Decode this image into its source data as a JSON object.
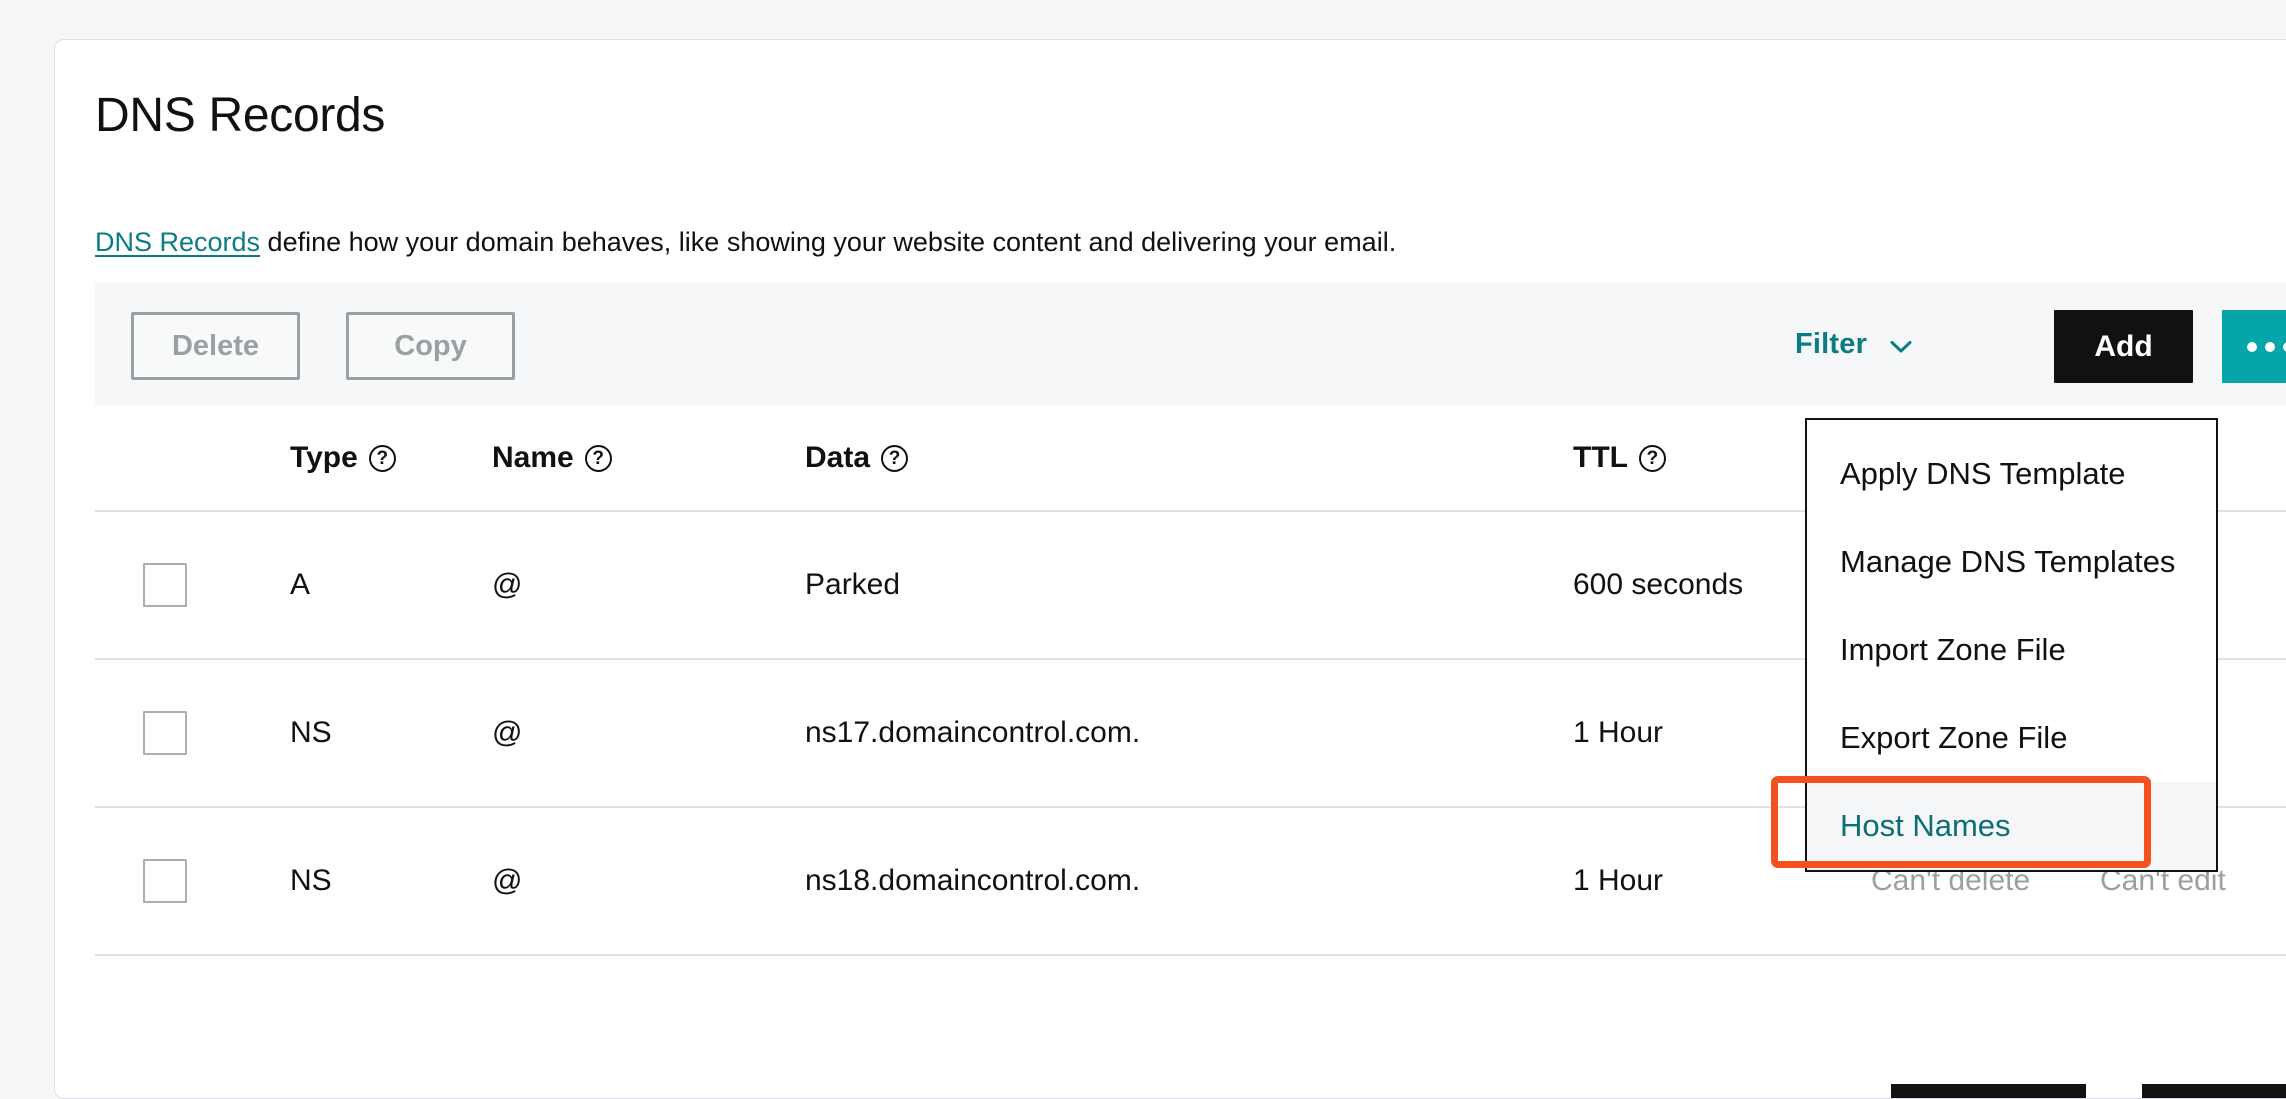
{
  "page": {
    "title": "DNS Records",
    "intro_link": "DNS Records",
    "intro_rest": " define how your domain behaves, like showing your website content and delivering your email."
  },
  "toolbar": {
    "delete_label": "Delete",
    "copy_label": "Copy",
    "filter_label": "Filter",
    "filter_chevron_icon": "chevron-down-icon",
    "add_label": "Add",
    "more_icon": "ellipsis-icon"
  },
  "menu": {
    "items": [
      {
        "label": "Apply DNS Template",
        "highlighted": false
      },
      {
        "label": "Manage DNS Templates",
        "highlighted": false
      },
      {
        "label": "Import Zone File",
        "highlighted": false
      },
      {
        "label": "Export Zone File",
        "highlighted": false
      },
      {
        "label": "Host Names",
        "highlighted": true
      }
    ]
  },
  "table": {
    "headers": {
      "type": "Type",
      "name": "Name",
      "data": "Data",
      "ttl": "TTL",
      "help_icon": "?"
    },
    "rows": [
      {
        "type": "A",
        "name": "@",
        "data": "Parked",
        "ttl": "600 seconds",
        "delete_action": "",
        "edit_action": ""
      },
      {
        "type": "NS",
        "name": "@",
        "data": "ns17.domaincontrol.com.",
        "ttl": "1 Hour",
        "delete_action": "",
        "edit_action": ""
      },
      {
        "type": "NS",
        "name": "@",
        "data": "ns18.domaincontrol.com.",
        "ttl": "1 Hour",
        "delete_action": "Can't delete",
        "edit_action": "Can't edit"
      }
    ]
  },
  "colors": {
    "teal": "#06a5a9",
    "teal_text": "#0b7c84",
    "black": "#111111",
    "annotation_orange": "#f4511e",
    "toolbar_bg": "#f5f7f8",
    "page_bg": "#f4f6f7",
    "muted": "#9aa0a4"
  }
}
